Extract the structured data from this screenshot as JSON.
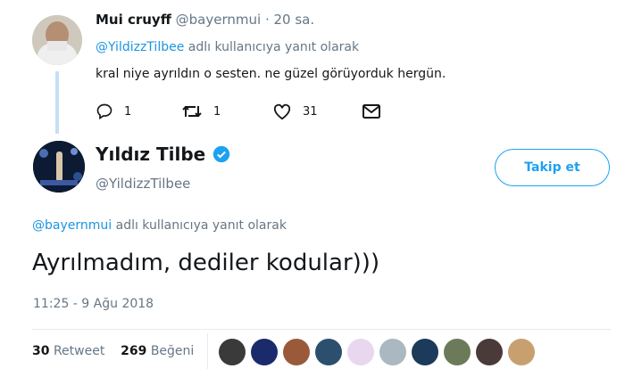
{
  "reply_tweet": {
    "display_name": "Mui cruyff",
    "handle": "@bayernmui",
    "separator": "·",
    "time": "20 sa.",
    "reply_mention": "@YildizzTilbee",
    "reply_suffix": "adlı kullanıcıya yanıt olarak",
    "text": "kral niye ayrıldın o sesten. ne güzel görüyorduk hergün.",
    "reply_count": "1",
    "retweet_count": "1",
    "like_count": "31",
    "icons": [
      "reply-icon",
      "retweet-icon",
      "like-icon",
      "message-icon"
    ]
  },
  "main_tweet": {
    "display_name": "Yıldız Tilbe",
    "handle": "@YildizzTilbee",
    "verified": true,
    "follow_label": "Takip et",
    "reply_mention": "@bayernmui",
    "reply_suffix": "adlı kullanıcıya yanıt olarak",
    "text": "Ayrılmadım, dediler kodular)))",
    "timestamp": "11:25 - 9 Ağu 2018",
    "retweets_count": "30",
    "retweets_label": "Retweet",
    "likes_count": "269",
    "likes_label": "Beğeni"
  },
  "colors": {
    "accent": "#1da1f2",
    "link": "#1b95e0",
    "muted": "#657786",
    "text": "#14171a",
    "thread_line": "#c4dff5",
    "divider": "#e6ecf0"
  },
  "liker_avatars": [
    {
      "name": "liker-avatar-1",
      "color": "#3a3a3a"
    },
    {
      "name": "liker-avatar-2",
      "color": "#1b2a6b"
    },
    {
      "name": "liker-avatar-3",
      "color": "#9a5a3a"
    },
    {
      "name": "liker-avatar-4",
      "color": "#2c4f6e"
    },
    {
      "name": "liker-avatar-5",
      "color": "#e9d7f0"
    },
    {
      "name": "liker-avatar-6",
      "color": "#aab8c2"
    },
    {
      "name": "liker-avatar-7",
      "color": "#1c3a5a"
    },
    {
      "name": "liker-avatar-8",
      "color": "#6b7b5a"
    },
    {
      "name": "liker-avatar-9",
      "color": "#4a3a3a"
    },
    {
      "name": "liker-avatar-10",
      "color": "#c8a070"
    }
  ]
}
